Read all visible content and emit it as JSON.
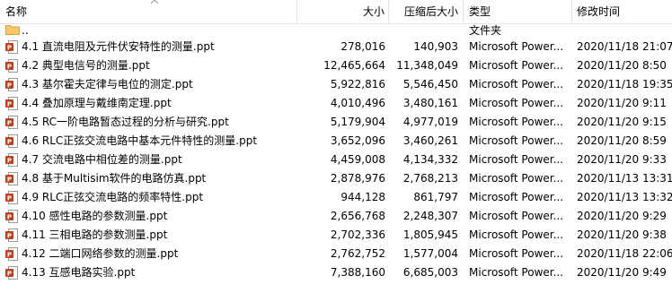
{
  "columns": {
    "name": "名称",
    "size": "大小",
    "compressed": "压缩后大小",
    "type": "类型",
    "modified": "修改时间"
  },
  "parent_row": {
    "name": "..",
    "type": "文件夹"
  },
  "colors": {
    "ppt_icon": "#c43e1c",
    "folder": "#f5c86a",
    "grid_line": "#e5e5e5"
  },
  "files": [
    {
      "name": "4.1 直流电阻及元件伏安特性的测量.ppt",
      "size": "278,016",
      "compressed": "140,903",
      "type": "Microsoft Power...",
      "modified": "2020/11/18 21:07"
    },
    {
      "name": "4.2 典型电信号的测量.ppt",
      "size": "12,465,664",
      "compressed": "11,348,049",
      "type": "Microsoft Power...",
      "modified": "2020/11/20 8:50"
    },
    {
      "name": "4.3 基尔霍夫定律与电位的测定.ppt",
      "size": "5,922,816",
      "compressed": "5,546,450",
      "type": "Microsoft Power...",
      "modified": "2020/11/18 19:35"
    },
    {
      "name": "4.4 叠加原理与戴维南定理.ppt",
      "size": "4,010,496",
      "compressed": "3,480,161",
      "type": "Microsoft Power...",
      "modified": "2020/11/20 9:11"
    },
    {
      "name": "4.5 RC一阶电路暂态过程的分析与研究.ppt",
      "size": "5,179,904",
      "compressed": "4,977,019",
      "type": "Microsoft Power...",
      "modified": "2020/11/20 9:15"
    },
    {
      "name": "4.6 RLC正弦交流电路中基本元件特性的测量.ppt",
      "size": "3,652,096",
      "compressed": "3,460,261",
      "type": "Microsoft Power...",
      "modified": "2020/11/20 8:59"
    },
    {
      "name": "4.7 交流电路中相位差的测量.ppt",
      "size": "4,459,008",
      "compressed": "4,134,332",
      "type": "Microsoft Power...",
      "modified": "2020/11/20 9:33"
    },
    {
      "name": "4.8 基于Multisim软件的电路仿真.ppt",
      "size": "2,878,976",
      "compressed": "2,768,213",
      "type": "Microsoft Power...",
      "modified": "2020/11/13 13:31"
    },
    {
      "name": "4.9 RLC正弦交流电路的频率特性.ppt",
      "size": "944,128",
      "compressed": "861,797",
      "type": "Microsoft Power...",
      "modified": "2020/11/13 13:32"
    },
    {
      "name": "4.10 感性电路的参数测量.ppt",
      "size": "2,656,768",
      "compressed": "2,248,307",
      "type": "Microsoft Power...",
      "modified": "2020/11/20 9:29"
    },
    {
      "name": "4.11 三相电路的参数测量.ppt",
      "size": "2,702,336",
      "compressed": "1,805,945",
      "type": "Microsoft Power...",
      "modified": "2020/11/20 9:38"
    },
    {
      "name": "4.12 二端口网络参数的测量.ppt",
      "size": "2,762,752",
      "compressed": "1,577,004",
      "type": "Microsoft Power...",
      "modified": "2020/11/18 22:06"
    },
    {
      "name": "4.13 互感电路实验.ppt",
      "size": "7,388,160",
      "compressed": "6,685,003",
      "type": "Microsoft Power...",
      "modified": "2020/11/20 9:49"
    }
  ]
}
